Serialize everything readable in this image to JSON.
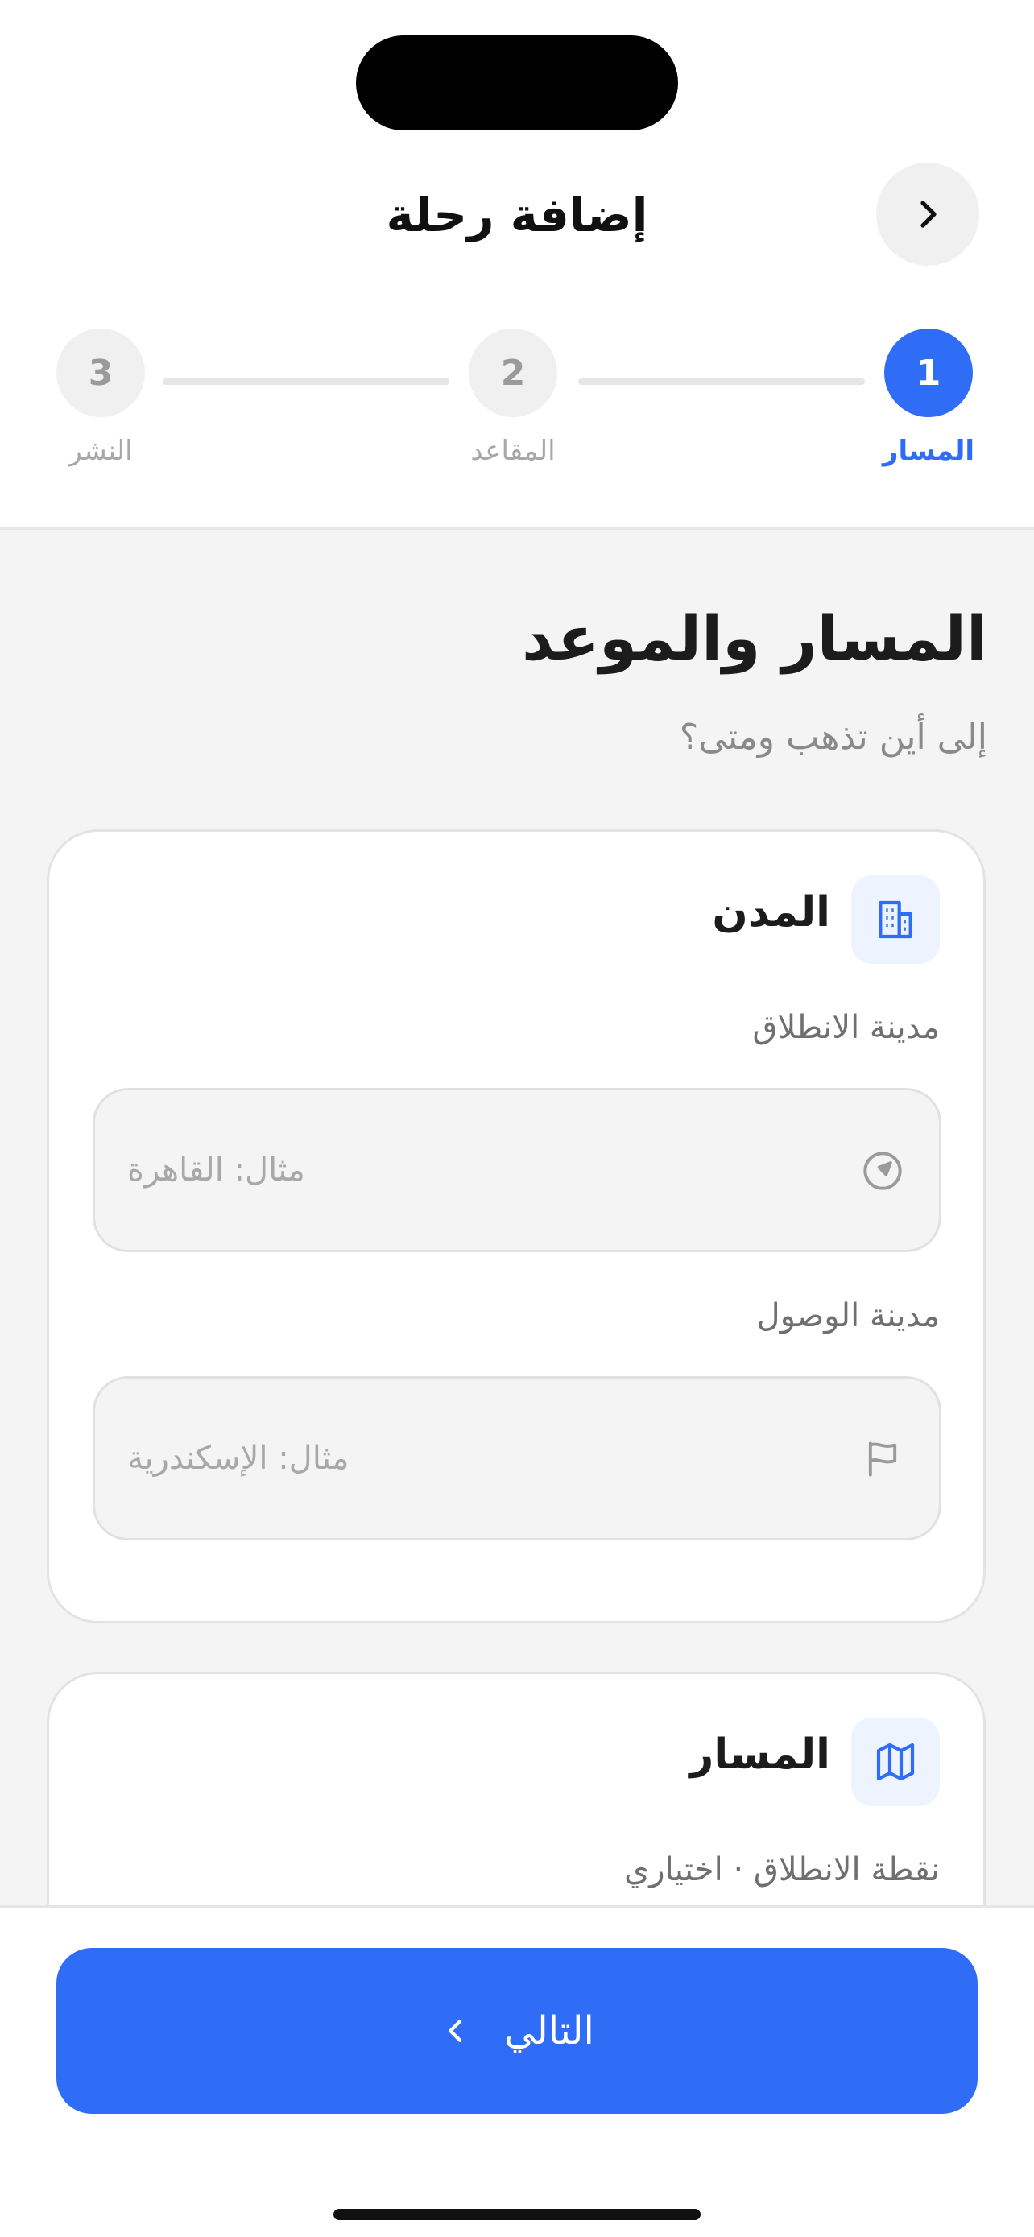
{
  "header": {
    "title": "إضافة رحلة"
  },
  "stepper": {
    "steps": [
      {
        "number": "1",
        "label": "المسار"
      },
      {
        "number": "2",
        "label": "المقاعد"
      },
      {
        "number": "3",
        "label": "النشر"
      }
    ]
  },
  "main": {
    "title": "المسار والموعد",
    "subtitle": "إلى أين تذهب ومتى؟",
    "cities_card": {
      "title": "المدن",
      "departure_label": "مدينة الانطلاق",
      "departure_placeholder": "مثال: القاهرة",
      "arrival_label": "مدينة الوصول",
      "arrival_placeholder": "مثال: الإسكندرية"
    },
    "route_card": {
      "title": "المسار",
      "start_point_label": "نقطة الانطلاق · اختياري"
    }
  },
  "footer": {
    "next_label": "التالي"
  },
  "colors": {
    "accent": "#2f6df6",
    "icon_bg": "#edf3ff",
    "page_bg": "#f4f4f4"
  },
  "icons": {
    "back": "chevron-right-icon",
    "cities": "building-icon",
    "departure": "navigation-arrow-icon",
    "arrival": "flag-icon",
    "route": "map-icon",
    "next": "chevron-left-icon"
  }
}
